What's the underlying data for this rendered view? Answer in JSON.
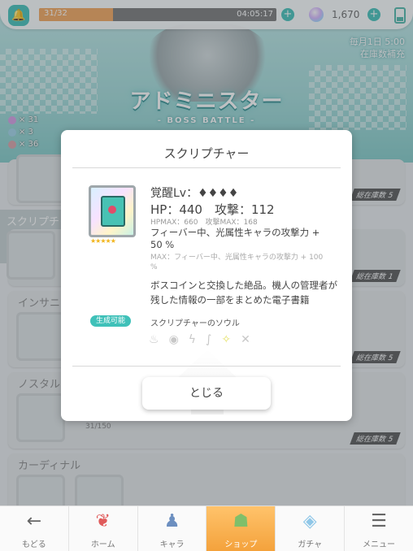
{
  "topbar": {
    "stamina_value": "31/32",
    "stamina_fraction": 0.31,
    "timer": "04:05:17",
    "gem_count": "1,670"
  },
  "banner": {
    "title": "アドミニスター",
    "subtitle": "- BOSS BATTLE -",
    "notice_line1": "毎月1日 5:00",
    "notice_line2": "在庫数補充",
    "items": [
      {
        "count": "× 31",
        "color": "#d59be3"
      },
      {
        "count": "× 3",
        "color": "#9fd3e8"
      },
      {
        "count": "× 36",
        "color": "#d8a0a7"
      }
    ]
  },
  "background_list": {
    "section_scripture": "スクリプチャー",
    "section_insanity": "インサニ",
    "section_nostalgia": "ノスタル",
    "section_cardinal": "カーディナル",
    "count_label": "総在庫数",
    "counts": [
      "5",
      "1",
      "5",
      "5"
    ],
    "progress_text": "31/150"
  },
  "modal": {
    "title": "スクリプチャー",
    "awaken": "覚醒Lv：♦♦♦♦",
    "hp_atk": "HP：440　攻撃：112",
    "hpmax": "HPMAX：660　攻撃MAX：168",
    "skill": "フィーバー中、光属性キャラの攻撃力 + 50 %",
    "skill_max": "MAX：フィーバー中、光属性キャラの攻撃力 + 100 %",
    "description": "ボスコインと交換した絶品。機人の管理者が残した情報の一部をまとめた電子書籍",
    "craft_badge": "生成可能",
    "soul_label": "スクリプチャーのソウル",
    "stars": "★★★★★",
    "close_button": "とじる",
    "elements": [
      "fire",
      "water",
      "thunder",
      "wind",
      "light",
      "dark"
    ]
  },
  "nav": {
    "back": "もどる",
    "home": "ホーム",
    "chara": "キャラ",
    "shop": "ショップ",
    "gacha": "ガチャ",
    "menu": "メニュー"
  },
  "colors": {
    "accent": "#3fc1b9",
    "stamina": "#f3a55a",
    "shop_active": "#f4a23c"
  }
}
